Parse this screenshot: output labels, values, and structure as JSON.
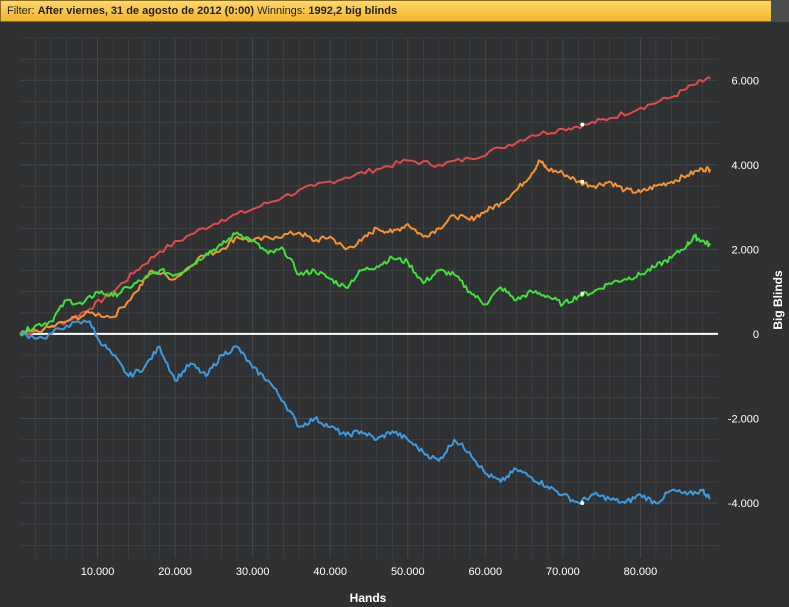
{
  "filter": {
    "label": "Filter:",
    "value": "After viernes, 31 de agosto de 2012 (0:00)",
    "winnings_label": "Winnings:",
    "winnings_value": "1992,2 big blinds"
  },
  "chart_data": {
    "type": "line",
    "title": "",
    "xlabel": "Hands",
    "ylabel": "Big Blinds",
    "xlim": [
      0,
      90000
    ],
    "ylim": [
      -5300,
      7000
    ],
    "x_ticks": [
      10000,
      20000,
      30000,
      40000,
      50000,
      60000,
      70000,
      80000
    ],
    "x_tick_labels": [
      "10.000",
      "20.000",
      "30.000",
      "40.000",
      "50.000",
      "60.000",
      "70.000",
      "80.000"
    ],
    "y_ticks": [
      6000,
      4000,
      2000,
      0,
      -2000,
      -4000
    ],
    "y_tick_labels": [
      "6.000",
      "4.000",
      "2.000",
      "0",
      "-2.000",
      "-4.000"
    ],
    "grid": true,
    "y_axis_position": "right",
    "colors": {
      "background": "#2f3133",
      "grid": "#45484b",
      "zero_line": "#ffffff",
      "text": "#ffffff"
    },
    "series": [
      {
        "color": "#e04a4a",
        "x": [
          0,
          3000,
          6000,
          9000,
          12000,
          15000,
          18000,
          22000,
          26000,
          30000,
          34000,
          38000,
          42000,
          46000,
          50000,
          54000,
          58000,
          62000,
          66000,
          70000,
          73000,
          76000,
          80000,
          84000,
          87000,
          89000
        ],
        "y": [
          0,
          100,
          300,
          600,
          1000,
          1500,
          1950,
          2350,
          2700,
          2950,
          3250,
          3500,
          3700,
          3900,
          4100,
          4000,
          4150,
          4400,
          4700,
          4850,
          4950,
          5100,
          5350,
          5600,
          5900,
          6050
        ]
      },
      {
        "color": "#f39234",
        "x": [
          0,
          3000,
          6000,
          9000,
          12000,
          15000,
          17000,
          20000,
          23000,
          26000,
          28000,
          30000,
          33000,
          36000,
          38000,
          40000,
          42000,
          44000,
          46000,
          48000,
          50000,
          52000,
          54000,
          56000,
          58000,
          60000,
          62000,
          64000,
          66000,
          67000,
          68000,
          70000,
          72000,
          74000,
          76000,
          78000,
          80000,
          82000,
          84000,
          86000,
          88000,
          89000
        ],
        "y": [
          0,
          100,
          300,
          500,
          400,
          1000,
          1500,
          1300,
          1800,
          2000,
          2300,
          2200,
          2300,
          2400,
          2200,
          2300,
          2000,
          2200,
          2500,
          2400,
          2600,
          2300,
          2500,
          2800,
          2700,
          2900,
          3100,
          3400,
          3800,
          4100,
          3900,
          3800,
          3600,
          3500,
          3600,
          3400,
          3350,
          3500,
          3600,
          3750,
          3900,
          3900
        ]
      },
      {
        "color": "#3fe03a",
        "x": [
          0,
          2000,
          4000,
          6000,
          8000,
          10000,
          12000,
          14000,
          16000,
          18000,
          20000,
          22000,
          24000,
          26000,
          28000,
          30000,
          32000,
          34000,
          36000,
          38000,
          40000,
          42000,
          44000,
          46000,
          48000,
          50000,
          52000,
          54000,
          56000,
          58000,
          60000,
          62000,
          64000,
          66000,
          68000,
          70000,
          72000,
          74000,
          76000,
          78000,
          80000,
          82000,
          84000,
          86000,
          87000,
          88000,
          89000
        ],
        "y": [
          0,
          200,
          300,
          800,
          700,
          1000,
          900,
          1100,
          1300,
          1500,
          1400,
          1600,
          1900,
          2100,
          2400,
          2200,
          1900,
          2000,
          1400,
          1500,
          1300,
          1100,
          1500,
          1600,
          1800,
          1700,
          1200,
          1500,
          1400,
          1000,
          700,
          1100,
          800,
          1000,
          900,
          700,
          900,
          1000,
          1200,
          1300,
          1400,
          1600,
          1800,
          2100,
          2300,
          2200,
          2100
        ]
      },
      {
        "color": "#3c9be0",
        "x": [
          0,
          3000,
          6000,
          9000,
          10000,
          12000,
          14000,
          16000,
          18000,
          20000,
          22000,
          24000,
          26000,
          28000,
          30000,
          32000,
          34000,
          36000,
          38000,
          40000,
          42000,
          44000,
          46000,
          48000,
          50000,
          52000,
          54000,
          56000,
          58000,
          60000,
          62000,
          64000,
          66000,
          68000,
          70000,
          72000,
          74000,
          76000,
          78000,
          80000,
          82000,
          84000,
          86000,
          88000,
          89000
        ],
        "y": [
          0,
          -100,
          200,
          300,
          -100,
          -500,
          -1000,
          -800,
          -300,
          -1100,
          -700,
          -1000,
          -500,
          -300,
          -800,
          -1100,
          -1600,
          -2200,
          -2000,
          -2200,
          -2400,
          -2300,
          -2500,
          -2300,
          -2500,
          -2800,
          -3000,
          -2500,
          -2800,
          -3300,
          -3500,
          -3200,
          -3400,
          -3600,
          -3800,
          -4000,
          -3800,
          -3900,
          -4000,
          -3800,
          -4000,
          -3700,
          -3800,
          -3700,
          -3900
        ]
      }
    ],
    "markers": [
      {
        "x": 72500,
        "y": 4950,
        "color": "#ffffff"
      },
      {
        "x": 72500,
        "y": 3600,
        "color": "#ffffff"
      },
      {
        "x": 72500,
        "y": 950,
        "color": "#ffffff"
      },
      {
        "x": 72500,
        "y": -4000,
        "color": "#ffffff"
      }
    ]
  }
}
